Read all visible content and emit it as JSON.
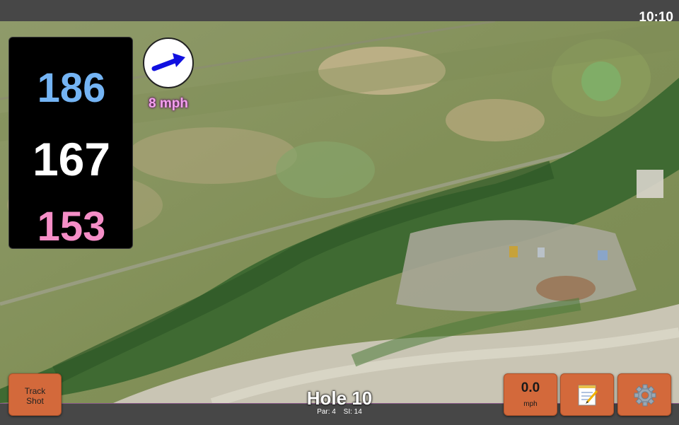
{
  "status_bar": {
    "time": "10:10"
  },
  "distances": {
    "back": "186",
    "middle": "167",
    "front": "153"
  },
  "wind": {
    "speed": "8 mph",
    "icon": "wind-direction-arrow-icon"
  },
  "hole": {
    "title": "Hole 10",
    "par_label": "Par: 4",
    "si_label": "SI: 14"
  },
  "buttons": {
    "track_shot_line1": "Track",
    "track_shot_line2": "Shot",
    "speed_value": "0.0",
    "speed_unit": "mph",
    "notes_icon": "notepad-icon",
    "settings_icon": "gear-icon"
  },
  "colors": {
    "back_distance": "#74b4f4",
    "middle_distance": "#ffffff",
    "front_distance": "#f58ec7",
    "wind_label": "#f4a0ee",
    "button": "#d3693b"
  }
}
